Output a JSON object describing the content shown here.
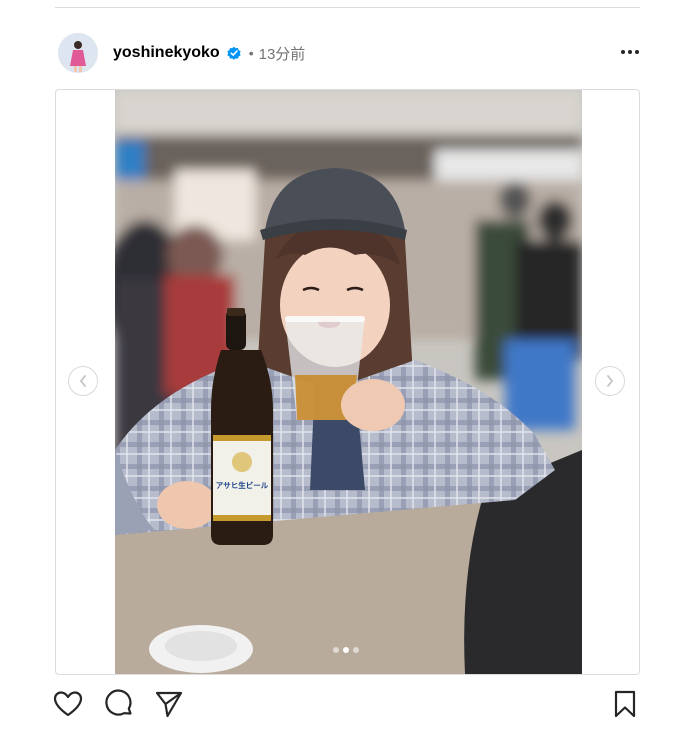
{
  "post": {
    "username": "yoshinekyoko",
    "separator": "•",
    "time_ago": "13分前",
    "verified": true
  },
  "media": {
    "bottle_label": "アサヒ生ビール",
    "carousel_total": 3,
    "carousel_active_index": 1
  },
  "icons": {
    "more": "more-options-icon",
    "prev": "chevron-left-icon",
    "next": "chevron-right-icon",
    "like": "heart-icon",
    "comment": "comment-bubble-icon",
    "share": "paper-plane-icon",
    "save": "bookmark-icon",
    "verified": "verified-badge-icon"
  },
  "colors": {
    "verified_blue": "#0095f6",
    "meta_gray": "#737373",
    "border": "#dbdbdb"
  }
}
